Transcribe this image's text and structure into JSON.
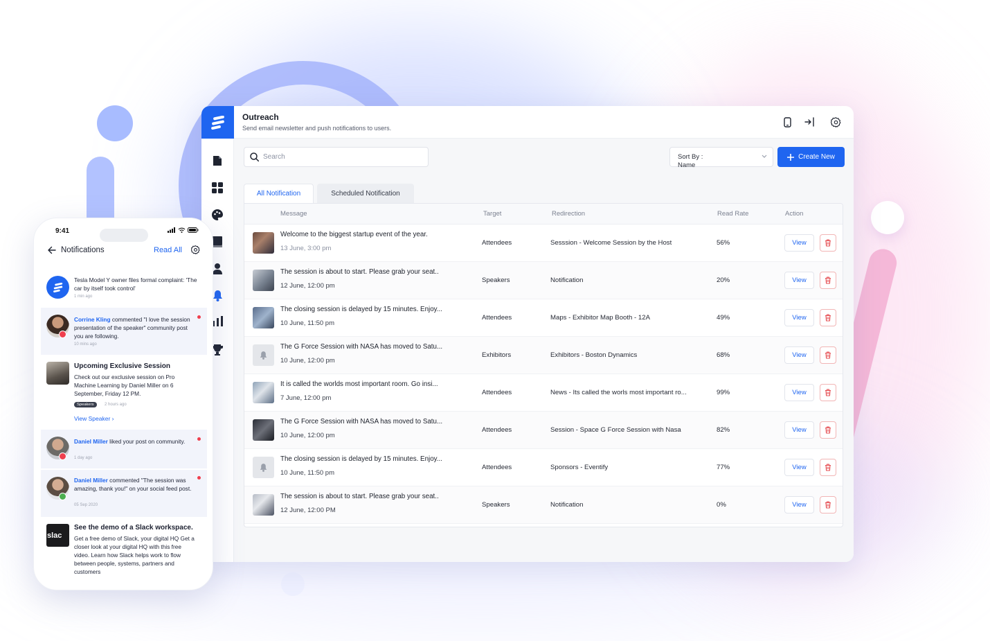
{
  "app": {
    "title": "Outreach",
    "subtitle": "Send email newsletter and push notifications to users."
  },
  "toolbar": {
    "search_placeholder": "Search",
    "sort_label": "Sort By :",
    "sort_value": "Name",
    "create_label": "Create New"
  },
  "tabs": [
    {
      "label": "All Notification",
      "active": true
    },
    {
      "label": "Scheduled Notification",
      "active": false
    }
  ],
  "table": {
    "headers": {
      "message": "Message",
      "target": "Target",
      "redirection": "Redirection",
      "read_rate": "Read Rate",
      "action": "Action"
    },
    "rows": [
      {
        "message": "Welcome to the biggest startup event of the year.",
        "date": "13 June, 3:00 pm",
        "target": "Attendees",
        "redirection": "Sesssion - Welcome Session by the Host",
        "read_rate": "56%",
        "thumb": "event-photo",
        "view": "View"
      },
      {
        "message": "The session is about to start. Please grab your seat..",
        "date": "12 June, 12:00 pm",
        "target": "Speakers",
        "redirection": "Notification",
        "read_rate": "20%",
        "thumb": "event-photo",
        "view": "View"
      },
      {
        "message": "The closing session is delayed by 15 minutes. Enjoy...",
        "date": "10 June, 11:50 pm",
        "target": "Attendees",
        "redirection": "Maps - Exhibitor Map Booth - 12A",
        "read_rate": "49%",
        "thumb": "event-photo",
        "view": "View"
      },
      {
        "message": "The G Force Session with NASA has moved to Satu...",
        "date": "10 June, 12:00 pm",
        "target": "Exhibitors",
        "redirection": "Exhibitors - Boston Dynamics",
        "read_rate": "68%",
        "thumb": "bell-icon",
        "view": "View"
      },
      {
        "message": "It is  called the worlds most important room. Go insi...",
        "date": "7 June, 12:00 pm",
        "target": "Attendees",
        "redirection": "News - Its called the worls most important ro...",
        "read_rate": "99%",
        "thumb": "event-photo",
        "view": "View"
      },
      {
        "message": "The G Force Session with NASA has moved to Satu...",
        "date": "10 June, 12:00 pm",
        "target": "Attendees",
        "redirection": "Session - Space G Force Session with Nasa",
        "read_rate": "82%",
        "thumb": "event-photo",
        "view": "View"
      },
      {
        "message": "The closing session is delayed by 15 minutes. Enjoy...",
        "date": "10 June, 11:50 pm",
        "target": "Attendees",
        "redirection": "Sponsors - Eventify",
        "read_rate": "77%",
        "thumb": "bell-icon",
        "view": "View"
      },
      {
        "message": "The session is about to start. Please grab your seat..",
        "date": "12 June, 12:00 PM",
        "target": "Speakers",
        "redirection": "Notification",
        "read_rate": "0%",
        "thumb": "event-photo",
        "view": "View"
      }
    ]
  },
  "phone": {
    "time": "9:41",
    "title": "Notifications",
    "read_all": "Read All",
    "notifications": [
      {
        "text": "Tesla Model Y owner files formal complaint: 'The car by itself took control'",
        "time": "1 min ago"
      },
      {
        "author": "Corrine Kling",
        "text": " commented \"I love the session presentation of the speaker\" community post you are following.",
        "time": "10 mins ago"
      },
      {
        "heading": "Upcoming Exclusive Session",
        "text": "Check out our exclusive session on Pro Machine Learning by Daniel Miller on 6 September, Friday 12 PM.",
        "tag": "Speakers",
        "time": "2 hours ago",
        "link": "View Speaker"
      },
      {
        "author": "Daniel Miller",
        "text": " liked your post on community.",
        "time": "1 day ago"
      },
      {
        "author": "Daniel Miller",
        "text": " commented \"The session was amazing, thank you!\" on your social feed post.",
        "time": "05 Sep 2020"
      },
      {
        "heading": "See the demo of a Slack workspace.",
        "text": "Get a free demo of Slack, your digital HQ Get a closer look at your digital HQ with this free video. Learn how Slack helps work to flow between people, systems, partners and customers",
        "logo_text": "slac"
      }
    ]
  },
  "colors": {
    "primary": "#1f65f0",
    "danger": "#ef3f4e"
  }
}
